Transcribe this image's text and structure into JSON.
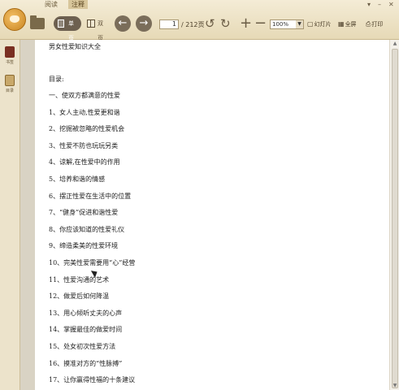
{
  "tabs": [
    {
      "label": "阅读"
    },
    {
      "label": "注释"
    }
  ],
  "toolbar": {
    "single_page": "单页",
    "double_page": "双页",
    "page_current": "1",
    "page_total": "/ 212页",
    "zoom_value": "100%",
    "slideshow": "幻灯片",
    "fullscreen": "全屏",
    "print": "打印",
    "window_menu": "▾",
    "window_minimize": "–",
    "window_close": "✕"
  },
  "sidebar": {
    "items": [
      {
        "label": "书签"
      },
      {
        "label": "目录"
      }
    ]
  },
  "document": {
    "title": "男女性爱知识大全",
    "toc_heading": "目录:",
    "toc_lines": [
      "一、使双方都满意的性爱",
      "1、女人主动,性爱更和谐",
      "2、挖掘被忽略的性爱机会",
      "3、性爱不防也玩玩另类",
      "4、谅解,在性爱中的作用",
      "5、培养和谐的情感",
      "6、摆正性爱在生活中的位置",
      "7、“健身”促进和谐性爱",
      "8、你应该知道的性爱礼仪",
      "9、缔造柔美的性爱环境",
      "10、完美性爱需要用“心”经营",
      "11、性爱沟通的艺术",
      "12、做爱后如何降温",
      "13、用心倾听丈夫的心声",
      "14、掌握最佳的做爱时间",
      "15、处女初次性爱方法",
      "16、摸准对方的“性脉搏”",
      "17、让你赢得性福的十条建议"
    ]
  },
  "colors": {
    "toolbar_bg": "#ece2c6",
    "page_bg": "#ffffff",
    "sidebar_bg": "#ece3cb"
  }
}
